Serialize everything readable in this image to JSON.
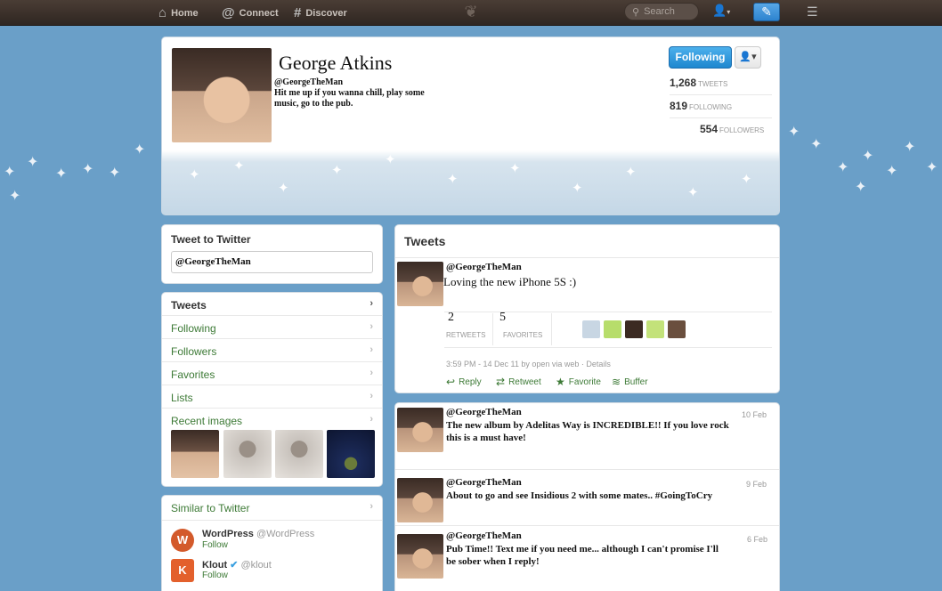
{
  "nav": {
    "home": "Home",
    "connect": "Connect",
    "discover": "Discover",
    "search_placeholder": "Search"
  },
  "profile": {
    "name": "George Atkins",
    "handle": "@GeorgeTheMan",
    "bio": "Hit me up if you wanna chill, play some music, go to the pub.",
    "following_button": "Following",
    "stats": [
      {
        "value": "1,268",
        "label": "TWEETS"
      },
      {
        "value": "819",
        "label": "FOLLOWING"
      },
      {
        "value": "554",
        "label": "FOLLOWERS"
      }
    ]
  },
  "tweet_box": {
    "title": "Tweet to Twitter",
    "value": "@GeorgeTheMan"
  },
  "sidebar_nav": [
    {
      "label": "Tweets"
    },
    {
      "label": "Following"
    },
    {
      "label": "Followers"
    },
    {
      "label": "Favorites"
    },
    {
      "label": "Lists"
    },
    {
      "label": "Recent images"
    }
  ],
  "similar": {
    "title": "Similar to Twitter",
    "items": [
      {
        "name": "WordPress",
        "handle": "@WordPress",
        "follow": "Follow"
      },
      {
        "name": "Klout",
        "handle": "@klout",
        "follow": "Follow"
      }
    ]
  },
  "tweets_panel": {
    "title": "Tweets",
    "featured": {
      "handle": "@GeorgeTheMan",
      "text": "Loving the new iPhone 5S :)",
      "retweets": "2",
      "retweets_label": "RETWEETS",
      "favorites": "5",
      "favorites_label": "FAVORITES",
      "meta": "3:59 PM - 14 Dec 11 by open via web · Details",
      "actions": {
        "reply": "Reply",
        "retweet": "Retweet",
        "favorite": "Favorite",
        "buffer": "Buffer"
      }
    }
  },
  "feed": [
    {
      "handle": "@GeorgeTheMan",
      "date": "10 Feb",
      "text": "The new album by Adelitas Way is INCREDIBLE!! If you love rock this is a must have!"
    },
    {
      "handle": "@GeorgeTheMan",
      "date": "9 Feb",
      "text": "About to go and see Insidious 2 with some mates.. #GoingToCry"
    },
    {
      "handle": "@GeorgeTheMan",
      "date": "6 Feb",
      "text": "Pub Time!! Text me if you need me... although I can't promise I'll be sober when I reply!"
    }
  ],
  "colors": {
    "accent": "#1e87cf",
    "link_green": "#3d7a36",
    "background": "#6a9fc8"
  }
}
